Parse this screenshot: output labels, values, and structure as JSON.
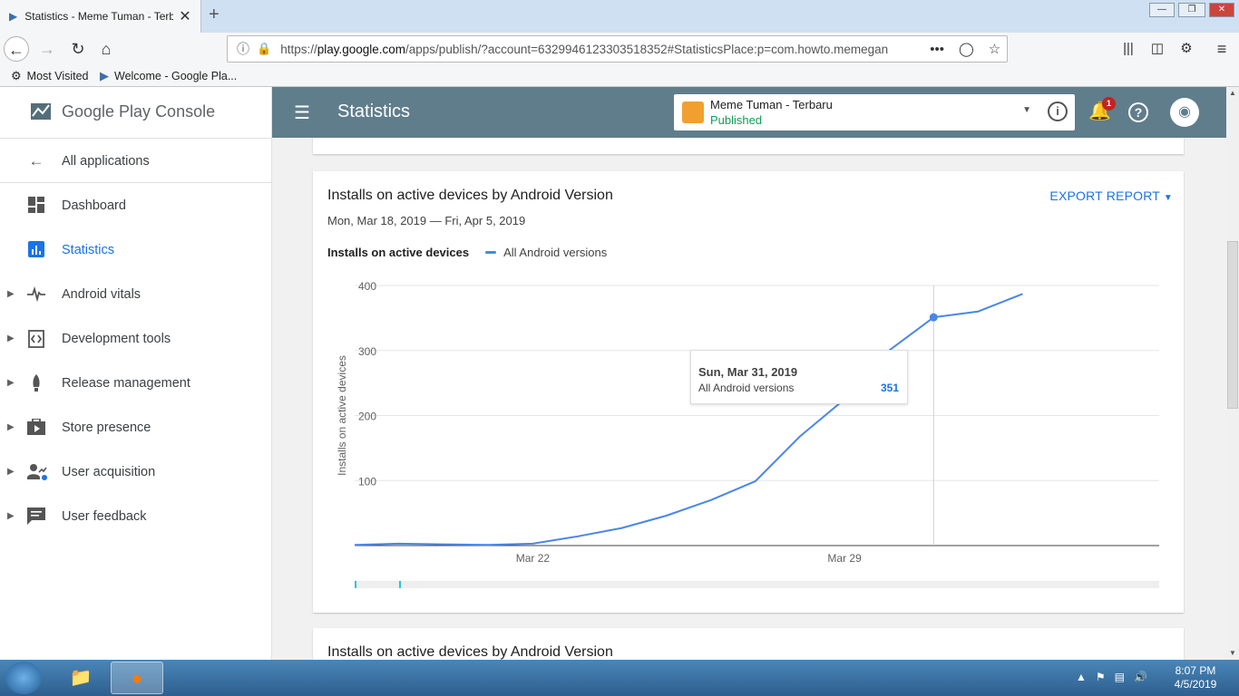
{
  "browser": {
    "tab_title": "Statistics - Meme Tuman - Terb",
    "url_prefix": "https://",
    "url_domain": "play.google.com",
    "url_rest": "/apps/publish/?account=6329946123303518352#StatisticsPlace:p=com.howto.memegan",
    "bookmarks": [
      {
        "label": "Most Visited",
        "icon": "gear-icon"
      },
      {
        "label": "Welcome - Google Pla...",
        "icon": "play-icon"
      }
    ]
  },
  "sidebar": {
    "logo_text_1": "Google Play ",
    "logo_text_2": "Console",
    "items": [
      {
        "label": "All applications",
        "icon": "arrow-back-icon",
        "active": false,
        "expandable": false
      },
      {
        "label": "Dashboard",
        "icon": "dashboard-icon",
        "active": false,
        "expandable": false
      },
      {
        "label": "Statistics",
        "icon": "bar-chart-icon",
        "active": true,
        "expandable": false
      },
      {
        "label": "Android vitals",
        "icon": "pulse-icon",
        "active": false,
        "expandable": true
      },
      {
        "label": "Development tools",
        "icon": "code-icon",
        "active": false,
        "expandable": true
      },
      {
        "label": "Release management",
        "icon": "rocket-icon",
        "active": false,
        "expandable": true
      },
      {
        "label": "Store presence",
        "icon": "store-icon",
        "active": false,
        "expandable": true
      },
      {
        "label": "User acquisition",
        "icon": "user-acquisition-icon",
        "active": false,
        "expandable": true
      },
      {
        "label": "User feedback",
        "icon": "feedback-icon",
        "active": false,
        "expandable": true
      }
    ]
  },
  "appbar": {
    "title": "Statistics",
    "app_name": "Meme Tuman - Terbaru",
    "app_status": "Published",
    "notification_count": "1",
    "header_color": "#607d8b"
  },
  "card": {
    "title": "Installs on active devices by Android Version",
    "date_range": "Mon, Mar 18, 2019 — Fri, Apr 5, 2019",
    "export_label": "EXPORT REPORT",
    "legend_title": "Installs on active devices",
    "tooltip": {
      "date": "Sun, Mar 31, 2019",
      "series": "All Android versions",
      "value": "351"
    }
  },
  "card2": {
    "title": "Installs on active devices by Android Version"
  },
  "chart_data": {
    "type": "line",
    "title": "",
    "xlabel": "",
    "ylabel": "Installs on active devices",
    "ylim": [
      0,
      400
    ],
    "yticks": [
      100,
      200,
      300,
      400
    ],
    "xticks": [
      "Mar 22",
      "Mar 29"
    ],
    "x": [
      "Mar 18",
      "Mar 19",
      "Mar 20",
      "Mar 21",
      "Mar 22",
      "Mar 23",
      "Mar 24",
      "Mar 25",
      "Mar 26",
      "Mar 27",
      "Mar 28",
      "Mar 29",
      "Mar 30",
      "Mar 31",
      "Apr 1",
      "Apr 2"
    ],
    "series": [
      {
        "name": "All Android versions",
        "color": "#4a86e8",
        "values": [
          1,
          3,
          2,
          1,
          3,
          14,
          27,
          46,
          70,
          99,
          168,
          225,
          300,
          351,
          360,
          387
        ]
      }
    ],
    "highlight": {
      "x": "Mar 31",
      "value": 351
    },
    "grid": true
  },
  "taskbar": {
    "time": "8:07 PM",
    "date": "4/5/2019"
  }
}
